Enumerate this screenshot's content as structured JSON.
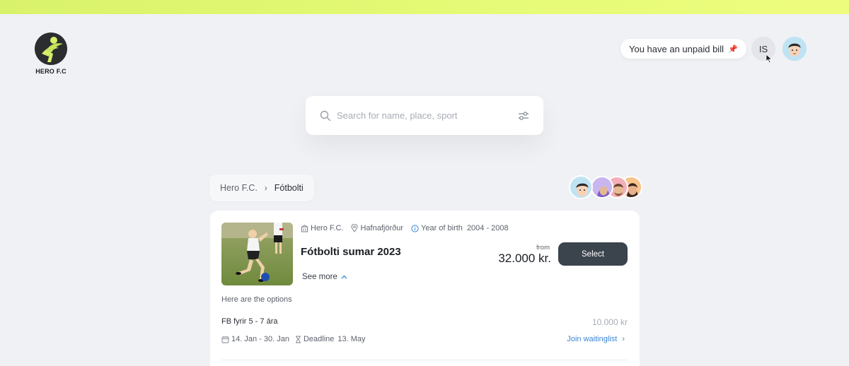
{
  "brand": {
    "logo_text": "HERO F.C"
  },
  "header": {
    "bill_text": "You have  an unpaid bill",
    "language_label": "IS"
  },
  "search": {
    "placeholder": "Search for name, place, sport"
  },
  "breadcrumb": {
    "club": "Hero F.C.",
    "section": "Fótbolti"
  },
  "course": {
    "club": "Hero F.C.",
    "location": "Hafnafjörður",
    "year_of_birth_label": "Year of birth",
    "year_range": "2004 - 2008",
    "title": "Fótbolti sumar 2023",
    "see_more": "See more",
    "price_prefix": "from",
    "price": "32.000 kr.",
    "select_label": "Select",
    "options_label": "Here are the options",
    "option": {
      "name_prefix": "FB",
      "name": "fyrir 5 - 7 ára",
      "price": "10.000 kr",
      "dates": "14. Jan - 30. Jan",
      "deadline_label": "Deadline",
      "deadline_date": "13. May",
      "waitlist": "Join waitinglist"
    }
  },
  "colors": {
    "accent_bar": "#e6fb77",
    "button": "#3b434d",
    "link": "#3a86d6",
    "background": "#f0f1f5"
  },
  "icons": [
    "search-icon",
    "filter-icon",
    "pin-icon",
    "cursor-icon",
    "building-icon",
    "location-icon",
    "info-icon",
    "chevron-right-icon",
    "chevron-up-icon",
    "calendar-icon",
    "hourglass-icon"
  ]
}
